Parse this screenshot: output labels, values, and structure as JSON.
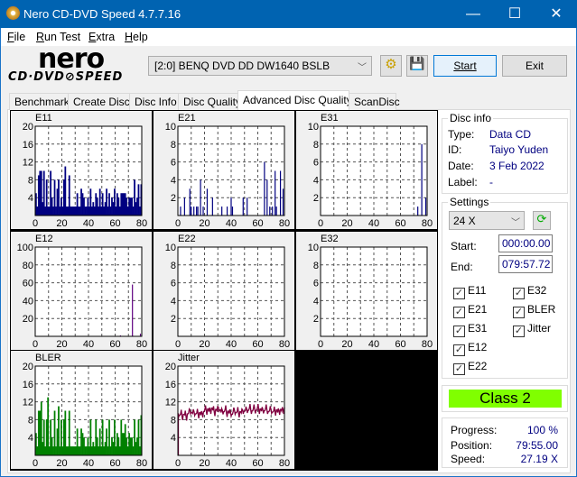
{
  "window": {
    "title": "Nero CD-DVD Speed 4.7.7.16",
    "minimize": "—",
    "maximize": "☐",
    "close": "✕"
  },
  "menu": [
    {
      "label": "File",
      "u": "F",
      "rest": "ile"
    },
    {
      "label": "Run Test",
      "u": "R",
      "rest": "un Test"
    },
    {
      "label": "Extra",
      "u": "E",
      "rest": "xtra"
    },
    {
      "label": "Help",
      "u": "H",
      "rest": "elp"
    }
  ],
  "logo": {
    "line1": "nero",
    "line2": "CD·DVD⊘SPEED"
  },
  "toolbar": {
    "drive": "[2:0]   BENQ DVD DD DW1640 BSLB",
    "start": "Start",
    "exit": "Exit"
  },
  "tabs": [
    "Benchmark",
    "Create Disc",
    "Disc Info",
    "Disc Quality",
    "Advanced Disc Quality",
    "ScanDisc"
  ],
  "active_tab": "Advanced Disc Quality",
  "disc_info": {
    "title": "Disc info",
    "type_label": "Type:",
    "type": "Data CD",
    "id_label": "ID:",
    "id": "Taiyo Yuden",
    "date_label": "Date:",
    "date": "3 Feb 2022",
    "label_label": "Label:",
    "label": "-"
  },
  "settings": {
    "title": "Settings",
    "speed": "24 X",
    "start_label": "Start:",
    "start": "000:00.00",
    "end_label": "End:",
    "end": "079:57.72",
    "checks": [
      {
        "label": "E11",
        "checked": true
      },
      {
        "label": "E21",
        "checked": true
      },
      {
        "label": "E31",
        "checked": true
      },
      {
        "label": "E12",
        "checked": true
      },
      {
        "label": "E22",
        "checked": true
      },
      {
        "label": "E32",
        "checked": true
      },
      {
        "label": "BLER",
        "checked": true
      },
      {
        "label": "Jitter",
        "checked": true
      }
    ]
  },
  "class": {
    "text": "Class 2",
    "color": "#80ff00"
  },
  "status": {
    "progress_label": "Progress:",
    "progress": "100 %",
    "position_label": "Position:",
    "position": "79:55.00",
    "speed_label": "Speed:",
    "speed": "27.19 X"
  },
  "chart_data": [
    {
      "name": "E11",
      "type": "bar",
      "color": "#000080",
      "xlim": [
        0,
        80
      ],
      "ylim": [
        0,
        20
      ],
      "yticks": [
        4,
        8,
        12,
        16,
        20
      ],
      "xticks": [
        0,
        20,
        40,
        60,
        80
      ],
      "grid": true,
      "values": [
        5,
        2,
        9,
        10,
        10,
        3,
        10,
        2,
        8,
        2,
        2,
        10,
        4,
        2,
        8,
        2,
        6,
        8,
        2,
        4,
        2,
        8,
        11,
        2,
        2,
        9,
        2,
        2,
        2,
        2,
        2,
        5,
        2,
        2,
        6,
        5,
        4,
        2,
        2,
        4,
        2,
        6,
        2,
        3,
        2,
        5,
        4,
        2,
        6,
        2,
        5,
        2,
        3,
        6,
        2,
        5,
        2,
        4,
        3,
        6,
        2,
        5,
        4,
        2,
        5,
        5,
        5,
        5,
        4,
        2,
        4,
        4,
        4,
        2,
        8,
        3,
        4,
        7,
        2,
        7
      ]
    },
    {
      "name": "E21",
      "type": "bar",
      "color": "#000080",
      "xlim": [
        0,
        80
      ],
      "ylim": [
        0,
        10
      ],
      "yticks": [
        2,
        4,
        6,
        8,
        10
      ],
      "xticks": [
        0,
        20,
        40,
        60,
        80
      ],
      "grid": true,
      "points": [
        [
          2,
          1
        ],
        [
          5,
          2
        ],
        [
          9,
          3
        ],
        [
          10,
          1
        ],
        [
          12,
          1
        ],
        [
          14,
          1
        ],
        [
          15,
          1
        ],
        [
          17,
          4
        ],
        [
          19,
          1
        ],
        [
          22,
          3
        ],
        [
          26,
          2
        ],
        [
          33,
          1
        ],
        [
          37,
          1
        ],
        [
          40,
          2
        ],
        [
          41,
          1
        ],
        [
          49,
          2
        ],
        [
          52,
          2
        ],
        [
          65,
          6
        ],
        [
          67,
          4
        ],
        [
          69,
          1
        ],
        [
          71,
          1
        ],
        [
          73,
          5
        ],
        [
          74,
          1
        ],
        [
          77,
          5
        ],
        [
          79,
          3
        ]
      ]
    },
    {
      "name": "E31",
      "type": "bar",
      "color": "#000080",
      "xlim": [
        0,
        80
      ],
      "ylim": [
        0,
        10
      ],
      "yticks": [
        2,
        4,
        6,
        8,
        10
      ],
      "xticks": [
        0,
        20,
        40,
        60,
        80
      ],
      "grid": true,
      "points": [
        [
          73,
          1
        ],
        [
          76,
          8
        ],
        [
          79,
          2
        ]
      ]
    },
    {
      "name": "E12",
      "type": "bar",
      "color": "#600080",
      "xlim": [
        0,
        80
      ],
      "ylim": [
        0,
        100
      ],
      "yticks": [
        20,
        40,
        60,
        80,
        100
      ],
      "xticks": [
        0,
        20,
        40,
        60,
        80
      ],
      "grid": true,
      "points": [
        [
          64,
          1
        ],
        [
          73,
          58
        ],
        [
          79,
          3
        ]
      ]
    },
    {
      "name": "E22",
      "type": "bar",
      "color": "#000080",
      "xlim": [
        0,
        80
      ],
      "ylim": [
        0,
        10
      ],
      "yticks": [
        2,
        4,
        6,
        8,
        10
      ],
      "xticks": [
        0,
        20,
        40,
        60,
        80
      ],
      "grid": true,
      "points": []
    },
    {
      "name": "E32",
      "type": "bar",
      "color": "#000080",
      "xlim": [
        0,
        80
      ],
      "ylim": [
        0,
        10
      ],
      "yticks": [
        2,
        4,
        6,
        8,
        10
      ],
      "xticks": [
        0,
        20,
        40,
        60,
        80
      ],
      "grid": true,
      "points": []
    },
    {
      "name": "BLER",
      "type": "bar",
      "color": "#008000",
      "xlim": [
        0,
        80
      ],
      "ylim": [
        0,
        20
      ],
      "yticks": [
        4,
        8,
        12,
        16,
        20
      ],
      "xticks": [
        0,
        20,
        40,
        60,
        80
      ],
      "grid": true,
      "values": [
        5,
        2,
        10,
        10,
        12,
        3,
        8,
        2,
        8,
        13,
        2,
        8,
        4,
        2,
        10,
        2,
        6,
        11,
        2,
        8,
        2,
        8,
        10,
        2,
        2,
        10,
        2,
        2,
        2,
        2,
        2,
        6,
        2,
        2,
        6,
        5,
        4,
        2,
        2,
        4,
        2,
        8,
        2,
        3,
        2,
        8,
        4,
        2,
        6,
        2,
        8,
        2,
        3,
        6,
        2,
        8,
        2,
        4,
        3,
        8,
        2,
        5,
        4,
        2,
        8,
        5,
        5,
        7,
        4,
        2,
        5,
        4,
        4,
        2,
        8,
        3,
        4,
        8,
        2,
        9
      ]
    },
    {
      "name": "Jitter",
      "type": "line",
      "color": "#800040",
      "xlim": [
        0,
        80
      ],
      "ylim": [
        0,
        20
      ],
      "yticks": [
        4,
        8,
        12,
        16,
        20
      ],
      "xticks": [
        0,
        20,
        40,
        60,
        80
      ],
      "grid": true,
      "values": [
        9.4,
        9.0,
        9.3,
        8.8,
        9.2,
        9.1,
        8.7,
        9.3,
        9.5,
        10.2,
        9.6,
        9.4,
        9.8,
        9.3,
        9.5,
        9.2,
        9.6,
        9.0,
        9.4,
        9.8,
        10.3,
        10.0,
        10.4,
        9.8,
        10.2,
        10.6,
        10.1,
        9.7,
        10.3,
        10.0,
        10.8,
        10.2,
        9.6,
        10.1,
        9.8,
        10.3,
        9.5,
        9.9,
        9.4,
        9.7,
        9.2,
        9.8,
        10.1,
        9.6,
        9.9,
        9.4,
        9.8,
        9.5,
        10.2,
        9.9,
        10.0,
        10.4,
        10.1,
        10.6,
        10.2,
        10.0,
        10.5,
        10.3,
        10.1,
        10.6,
        10.2,
        10.4,
        9.9,
        10.3,
        10.0,
        10.5,
        10.2,
        9.8,
        10.1,
        10.3,
        9.7,
        10.0,
        9.8,
        10.2,
        9.6,
        10.0,
        10.3,
        9.9,
        10.2,
        10.6
      ]
    }
  ]
}
